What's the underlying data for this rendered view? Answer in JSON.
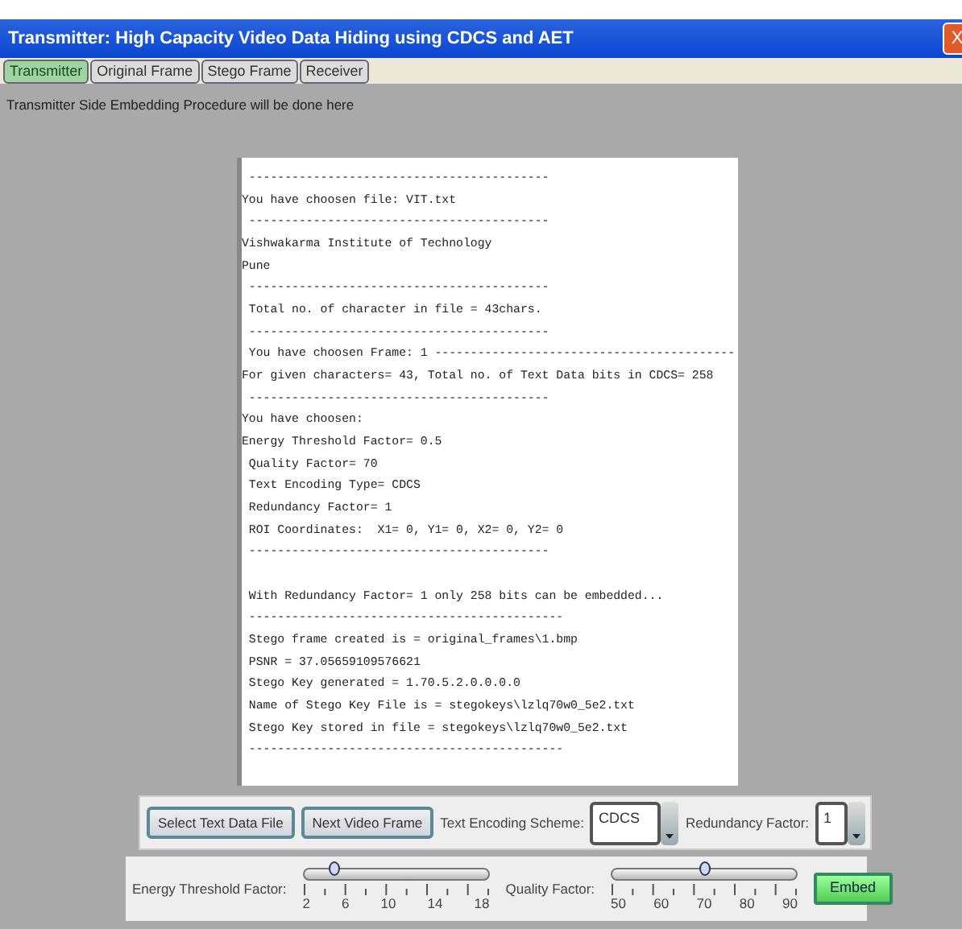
{
  "window": {
    "title": "Transmitter: High Capacity Video Data Hiding using CDCS and AET",
    "close": "X"
  },
  "tabs": [
    {
      "label": "Transmitter",
      "selected": true
    },
    {
      "label": "Original Frame",
      "selected": false
    },
    {
      "label": "Stego Frame",
      "selected": false
    },
    {
      "label": "Receiver",
      "selected": false
    }
  ],
  "panel": {
    "title": "Transmitter Side Embedding Procedure will be done here"
  },
  "log": [
    {
      "text": " ------------------------------------------"
    },
    {
      "text": "You have choosen file: VIT.txt"
    },
    {
      "text": " ------------------------------------------"
    },
    {
      "text": "Vishwakarma Institute of Technology"
    },
    {
      "text": "Pune"
    },
    {
      "text": " ------------------------------------------"
    },
    {
      "text": " Total no. of character in file = 43chars."
    },
    {
      "text": " ------------------------------------------"
    },
    {
      "text": " You have choosen Frame: 1 ------------------------------------------"
    },
    {
      "text": "For given characters= 43, Total no. of Text Data bits in CDCS= 258"
    },
    {
      "text": " ------------------------------------------"
    },
    {
      "text": "You have choosen:"
    },
    {
      "text": "Energy Threshold Factor= 0.5"
    },
    {
      "text": " Quality Factor= 70"
    },
    {
      "text": " Text Encoding Type= CDCS"
    },
    {
      "text": " Redundancy Factor= 1"
    },
    {
      "text": " ROI Coordinates:  X1= 0, Y1= 0, X2= 0, Y2= 0"
    },
    {
      "text": " ------------------------------------------"
    },
    {
      "text": " With Redundancy Factor= 1 only 258 bits can be embedded...",
      "spaced": true
    },
    {
      "text": " --------------------------------------------"
    },
    {
      "text": " Stego frame created is = original_frames\\1.bmp"
    },
    {
      "text": " PSNR = 37.05659109576621"
    },
    {
      "text": " Stego Key generated = 1.70.5.2.0.0.0.0"
    },
    {
      "text": " Name of Stego Key File is = stegokeys\\lzlq70w0_5e2.txt"
    },
    {
      "text": " Stego Key stored in file = stegokeys\\lzlq70w0_5e2.txt"
    },
    {
      "text": " --------------------------------------------"
    }
  ],
  "controls": {
    "buttons": [
      "Select Text Data File",
      "Next Video Frame"
    ],
    "encoding": {
      "label": "Text Encoding Scheme:",
      "value": "CDCS"
    },
    "redundancy": {
      "label": "Redundancy Factor:",
      "value": "1"
    }
  },
  "sliders": [
    {
      "label": "Energy Threshold Factor:",
      "level": 0.16,
      "ticks": [
        "2",
        "6",
        "10",
        "14",
        "18"
      ]
    },
    {
      "label": "Quality Factor:",
      "level": 0.5,
      "ticks": [
        "50",
        "60",
        "70",
        "80",
        "90"
      ]
    }
  ],
  "embed": "Embed"
}
